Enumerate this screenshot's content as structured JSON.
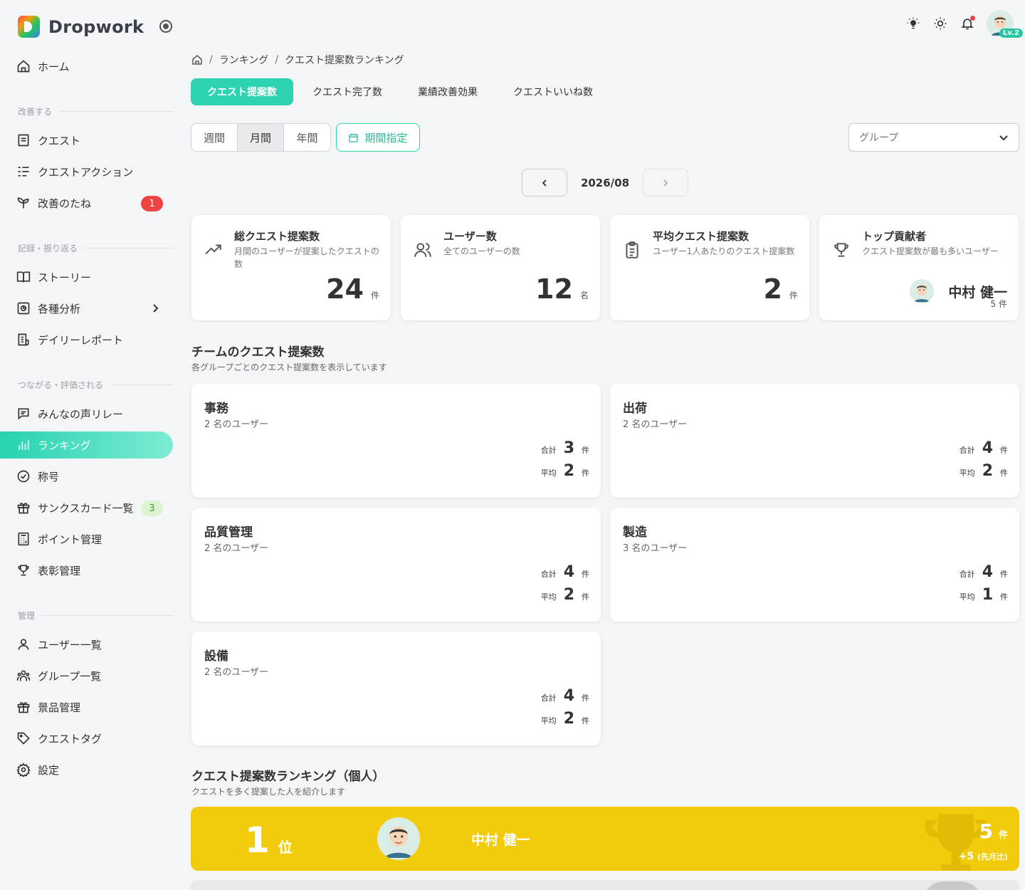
{
  "brand": {
    "name": "Dropwork"
  },
  "sidebar": {
    "home": "ホーム",
    "sections": [
      {
        "label": "改善する"
      },
      {
        "label": "記録・振り返る"
      },
      {
        "label": "つながる・評価される"
      },
      {
        "label": "管理"
      }
    ],
    "items": {
      "quest": "クエスト",
      "quest_action": "クエストアクション",
      "kaizen_seeds": "改善のたね",
      "kaizen_seeds_badge": "1",
      "story": "ストーリー",
      "analysis": "各種分析",
      "daily_report": "デイリーレポート",
      "voice_relay": "みんなの声リレー",
      "ranking": "ランキング",
      "title": "称号",
      "thanks_cards": "サンクスカード一覧",
      "thanks_cards_badge": "3",
      "points": "ポイント管理",
      "awards": "表彰管理",
      "users": "ユーザー一覧",
      "groups": "グループ一覧",
      "prizes": "景品管理",
      "quest_tags": "クエストタグ",
      "settings": "設定"
    }
  },
  "header": {
    "level_badge": "Lv.2"
  },
  "breadcrumb": {
    "ranking": "ランキング",
    "current": "クエスト提案数ランキング"
  },
  "tabs": [
    {
      "label": "クエスト提案数",
      "active": true
    },
    {
      "label": "クエスト完了数",
      "active": false
    },
    {
      "label": "業績改善効果",
      "active": false
    },
    {
      "label": "クエストいいね数",
      "active": false
    }
  ],
  "period": {
    "weekly": "週間",
    "monthly": "月間",
    "yearly": "年間",
    "selected": "月間",
    "custom": "期間指定"
  },
  "group_select": {
    "placeholder": "グループ"
  },
  "pager": {
    "month": "2026/08"
  },
  "stats": [
    {
      "title": "総クエスト提案数",
      "desc": "月間のユーザーが提案したクエストの数",
      "value": "24",
      "unit": "件",
      "icon": "trending-up-icon"
    },
    {
      "title": "ユーザー数",
      "desc": "全てのユーザーの数",
      "value": "12",
      "unit": "名",
      "icon": "users-icon"
    },
    {
      "title": "平均クエスト提案数",
      "desc": "ユーザー1人あたりのクエスト提案数",
      "value": "2",
      "unit": "件",
      "icon": "clipboard-icon"
    },
    {
      "title": "トップ貢献者",
      "desc": "クエスト提案数が最も多いユーザー",
      "user": "中村 健一",
      "count": "5 件",
      "icon": "trophy-icon"
    }
  ],
  "team_section": {
    "title": "チームのクエスト提案数",
    "subtitle": "各グループごとのクエスト提案数を表示しています",
    "total_label": "合計",
    "avg_label": "平均",
    "unit": "件"
  },
  "teams": [
    {
      "name": "事務",
      "users": "2 名のユーザー",
      "total": "3",
      "avg": "2"
    },
    {
      "name": "出荷",
      "users": "2 名のユーザー",
      "total": "4",
      "avg": "2"
    },
    {
      "name": "品質管理",
      "users": "2 名のユーザー",
      "total": "4",
      "avg": "2"
    },
    {
      "name": "製造",
      "users": "3 名のユーザー",
      "total": "4",
      "avg": "1"
    },
    {
      "name": "設備",
      "users": "2 名のユーザー",
      "total": "4",
      "avg": "2"
    }
  ],
  "ranking_section": {
    "title": "クエスト提案数ランキング（個人）",
    "subtitle": "クエストを多く提案した人を紹介します"
  },
  "ranking": [
    {
      "rank": "1",
      "rank_unit": "位",
      "name": "中村 健一",
      "count": "5",
      "count_unit": "件",
      "diff": "+5",
      "diff_label": "(先月比)",
      "color": "#f2cb0c"
    }
  ]
}
